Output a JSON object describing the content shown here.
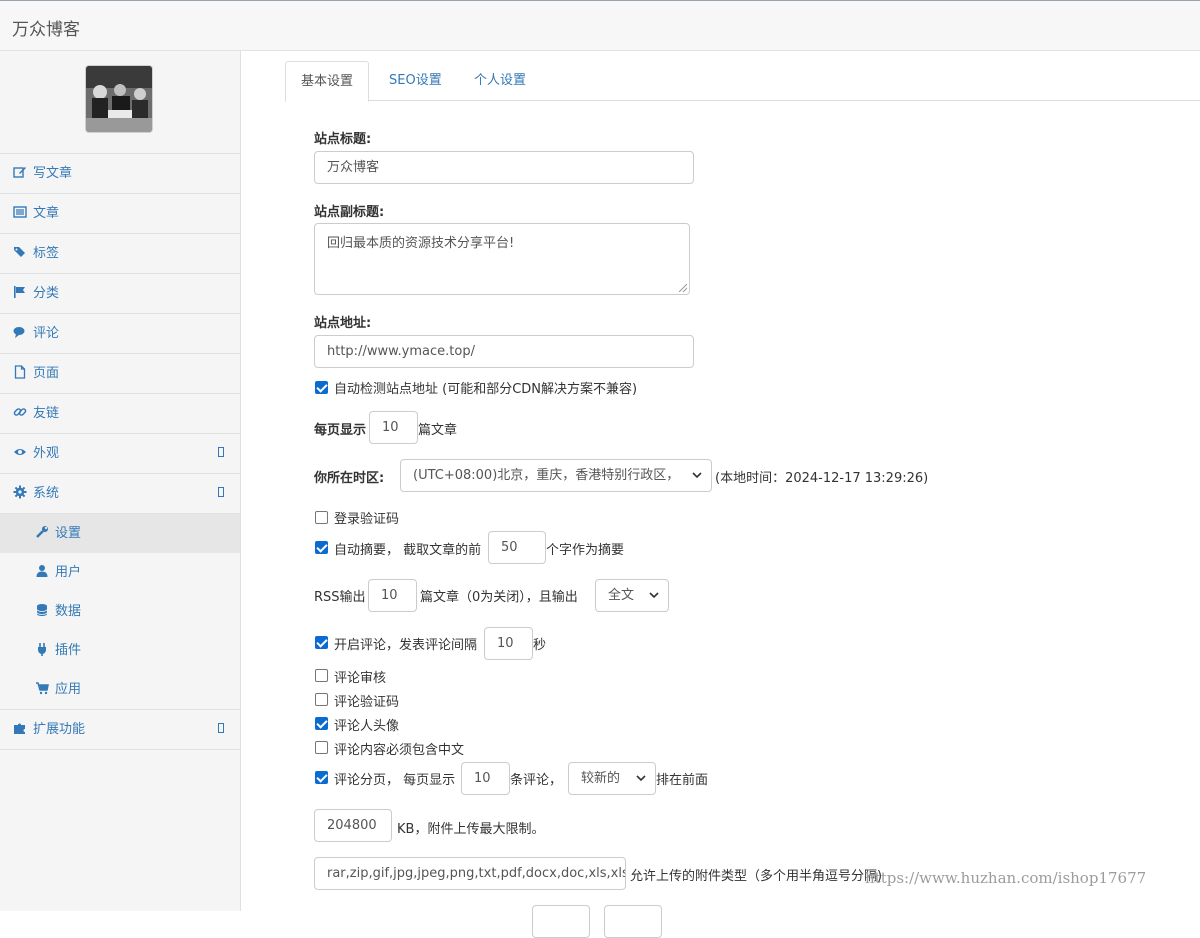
{
  "app": {
    "title": "万众博客"
  },
  "sidebar": {
    "items": [
      {
        "label": "写文章",
        "icon": "edit-icon"
      },
      {
        "label": "文章",
        "icon": "list-icon"
      },
      {
        "label": "标签",
        "icon": "tags-icon"
      },
      {
        "label": "分类",
        "icon": "flag-icon"
      },
      {
        "label": "评论",
        "icon": "comments-icon"
      },
      {
        "label": "页面",
        "icon": "file-icon"
      },
      {
        "label": "友链",
        "icon": "link-icon"
      },
      {
        "label": "外观",
        "icon": "eye-icon"
      },
      {
        "label": "系统",
        "icon": "gear-icon"
      }
    ],
    "system_sub": [
      {
        "label": "设置",
        "icon": "wrench-icon"
      },
      {
        "label": "用户",
        "icon": "user-icon"
      },
      {
        "label": "数据",
        "icon": "database-icon"
      },
      {
        "label": "插件",
        "icon": "plug-icon"
      },
      {
        "label": "应用",
        "icon": "cart-icon"
      }
    ],
    "extend": {
      "label": "扩展功能",
      "icon": "puzzle-icon"
    }
  },
  "tabs": [
    "基本设置",
    "SEO设置",
    "个人设置"
  ],
  "form": {
    "site_title_label": "站点标题:",
    "site_title": "万众博客",
    "subtitle_label": "站点副标题:",
    "subtitle": "回归最本质的资源技术分享平台!",
    "url_label": "站点地址:",
    "url": "http://www.ymace.top/",
    "auto_detect": "自动检测站点地址 (可能和部分CDN解决方案不兼容)",
    "per_page_prefix": "每页显示",
    "per_page": "10",
    "per_page_suffix": "篇文章",
    "timezone_label": "你所在时区:",
    "timezone": "(UTC+08:00)北京，重庆，香港特别行政区，",
    "local_time": "(本地时间：2024-12-17 13:29:26)",
    "login_captcha": "登录验证码",
    "auto_summary_prefix": "自动摘要， 截取文章的前",
    "summary_len": "50",
    "auto_summary_suffix": "个字作为摘要",
    "rss_prefix": "RSS输出",
    "rss_count": "10",
    "rss_middle": "篇文章（0为关闭），且输出",
    "rss_mode": "全文",
    "comment_open_prefix": "开启评论，发表评论间隔",
    "comment_interval": "10",
    "comment_interval_suffix": "秒",
    "comment_review": "评论审核",
    "comment_captcha": "评论验证码",
    "comment_avatar": "评论人头像",
    "comment_chinese": "评论内容必须包含中文",
    "comment_page_prefix": "评论分页， 每页显示",
    "comment_page_count": "10",
    "comment_page_middle": "条评论，",
    "comment_order": "较新的",
    "comment_order_suffix": "排在前面",
    "upload_limit": "204800",
    "upload_limit_suffix": "KB，附件上传最大限制。",
    "upload_types": "rar,zip,gif,jpg,jpeg,png,txt,pdf,docx,doc,xls,xlsx,m",
    "upload_types_suffix": "允许上传的附件类型（多个用半角逗号分隔)"
  },
  "watermark": "https://www.huzhan.com/ishop17677",
  "colors": {
    "link": "#3479b7",
    "checkbox": "#0b6bd3"
  }
}
